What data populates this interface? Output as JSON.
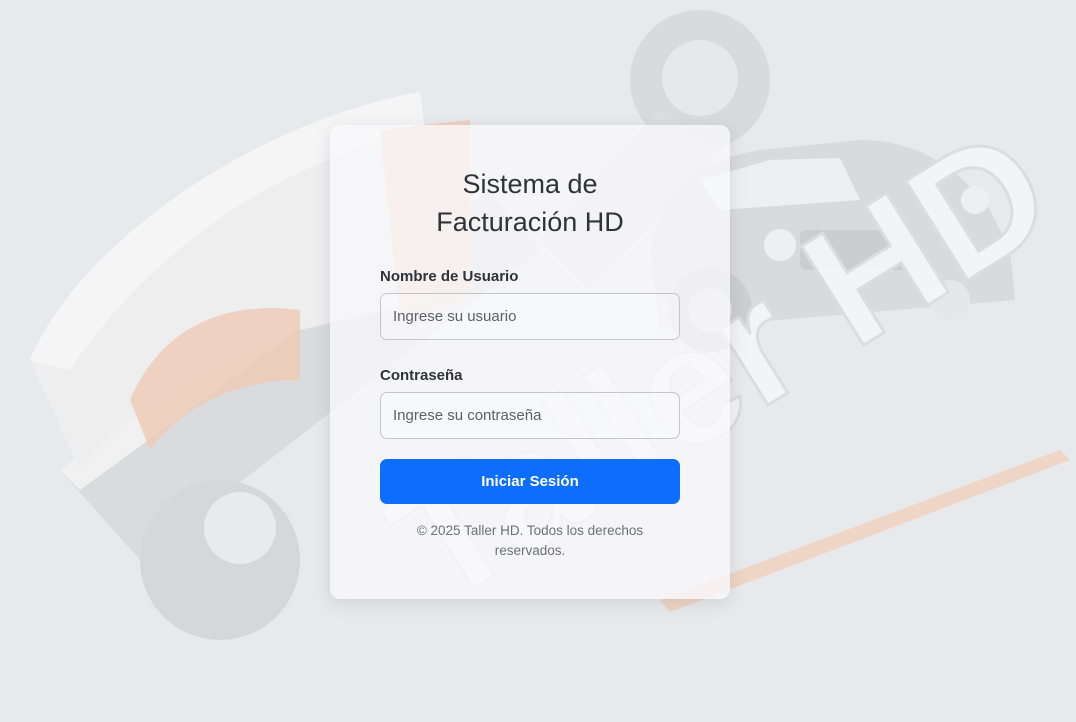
{
  "login": {
    "title": "Sistema de Facturación HD",
    "username": {
      "label": "Nombre de Usuario",
      "placeholder": "Ingrese su usuario",
      "value": ""
    },
    "password": {
      "label": "Contraseña",
      "placeholder": "Ingrese su contraseña",
      "value": ""
    },
    "submit_label": "Iniciar Sesión",
    "footer": "© 2025 Taller HD. Todos los derechos reservados."
  },
  "background": {
    "watermark_text": "Taller HD",
    "image": "wrench-and-classic-car-logo"
  },
  "colors": {
    "primary": "#0d6efd",
    "page_bg": "#e9eaed",
    "text": "#2f3338",
    "muted": "#6b7078"
  }
}
